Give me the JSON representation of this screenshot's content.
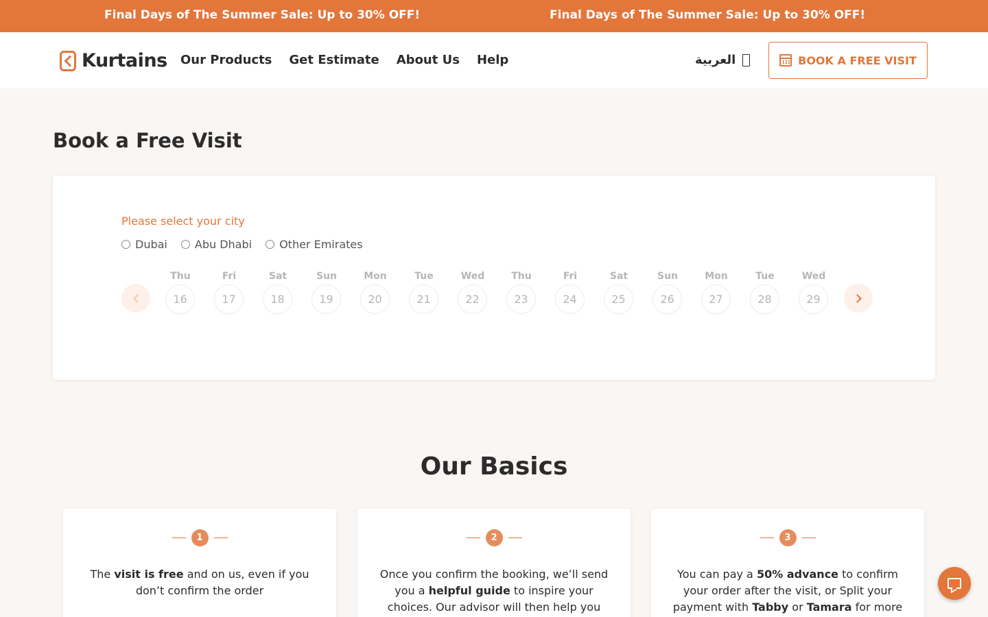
{
  "promo": {
    "message_1": "Final Days of The Summer Sale: Up to 30% OFF!",
    "message_2": "Final Days of The Summer Sale: Up to 30% OFF!"
  },
  "header": {
    "logo_text": "Kurtains",
    "nav": [
      "Our Products",
      "Get Estimate",
      "About Us",
      "Help"
    ],
    "language": "العربية",
    "book_button": "BOOK A FREE VISIT"
  },
  "booking": {
    "title": "Book a Free Visit",
    "city_label": "Please select your city",
    "cities": [
      "Dubai",
      "Abu Dhabi",
      "Other Emirates"
    ],
    "days": [
      {
        "name": "Thu",
        "date": "16"
      },
      {
        "name": "Fri",
        "date": "17"
      },
      {
        "name": "Sat",
        "date": "18"
      },
      {
        "name": "Sun",
        "date": "19"
      },
      {
        "name": "Mon",
        "date": "20"
      },
      {
        "name": "Tue",
        "date": "21"
      },
      {
        "name": "Wed",
        "date": "22"
      },
      {
        "name": "Thu",
        "date": "23"
      },
      {
        "name": "Fri",
        "date": "24"
      },
      {
        "name": "Sat",
        "date": "25"
      },
      {
        "name": "Sun",
        "date": "26"
      },
      {
        "name": "Mon",
        "date": "27"
      },
      {
        "name": "Tue",
        "date": "28"
      },
      {
        "name": "Wed",
        "date": "29"
      }
    ]
  },
  "basics": {
    "title": "Our Basics",
    "cards": [
      {
        "number": "1",
        "segments": [
          {
            "t": "The "
          },
          {
            "t": "visit is free",
            "b": true
          },
          {
            "t": " and on us, even if you don’t confirm the order"
          }
        ]
      },
      {
        "number": "2",
        "segments": [
          {
            "t": "Once you confirm the booking, we’ll send you a "
          },
          {
            "t": "helpful guide",
            "b": true
          },
          {
            "t": " to inspire your choices. Our advisor will then help you"
          }
        ]
      },
      {
        "number": "3",
        "segments": [
          {
            "t": "You can pay a "
          },
          {
            "t": "50% advance",
            "b": true
          },
          {
            "t": " to confirm your order after the visit, or Split your payment with "
          },
          {
            "t": "Tabby",
            "b": true
          },
          {
            "t": " or "
          },
          {
            "t": "Tamara",
            "b": true
          },
          {
            "t": " for more"
          }
        ]
      }
    ]
  },
  "colors": {
    "accent": "#e2763b",
    "background": "#faf6f3"
  },
  "icons": {
    "book_button": "calendar-icon",
    "language": "phone-icon",
    "chat": "chat-icon",
    "prev": "chevron-left-icon",
    "next": "chevron-right-icon"
  }
}
